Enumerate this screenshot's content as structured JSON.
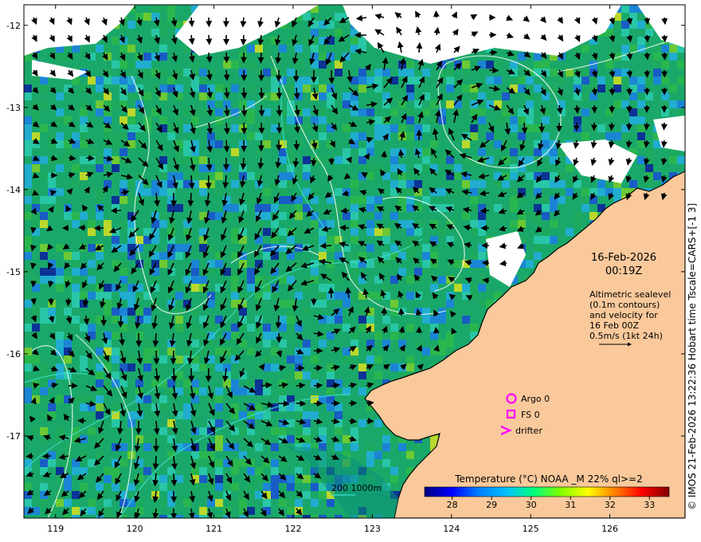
{
  "map": {
    "x_ticks": [
      "119",
      "120",
      "121",
      "122",
      "123",
      "124",
      "125",
      "126"
    ],
    "y_ticks": [
      "-12",
      "-13",
      "-14",
      "-15",
      "-16",
      "-17"
    ],
    "lon_range": [
      118.6,
      126.95
    ],
    "lat_range": [
      -11.75,
      -18.0
    ]
  },
  "annotation": {
    "date": "16-Feb-2026",
    "time": "00:19Z",
    "lines": [
      "Altimetric sealevel",
      "(0.1m contours)",
      "and velocity for",
      "16 Feb 00Z",
      "0.5m/s (1kt 24h)"
    ]
  },
  "legend": {
    "argo": "Argo 0",
    "fs": "FS 0",
    "drifter": "drifter",
    "bathymetry": "200  1000m",
    "colors": {
      "marker": "#ff00ff",
      "bathy": "#40e0d0",
      "land": "#fac99b"
    }
  },
  "colorbar": {
    "title": "Temperature (°C) NOAA _M 22% ql>=2",
    "ticks": [
      "28",
      "29",
      "30",
      "31",
      "32",
      "33"
    ],
    "range": [
      27.3,
      33.5
    ],
    "stops": [
      "#000080",
      "#0000ff",
      "#0080ff",
      "#00c0ff",
      "#00ff80",
      "#80ff00",
      "#ffff00",
      "#ff8000",
      "#ff0000",
      "#800000"
    ]
  },
  "side_credit": "© IMOS 21-Feb-2026 13:22:36 Hobart time Tscale=CARS+[-1 3]"
}
